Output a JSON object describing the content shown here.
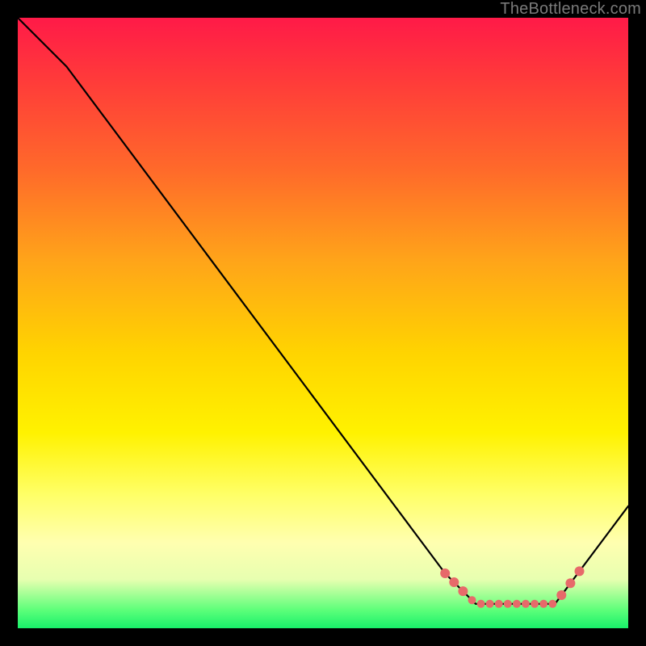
{
  "attribution": "TheBottleneck.com",
  "chart_data": {
    "type": "line",
    "title": "",
    "xlabel": "",
    "ylabel": "",
    "xlim": [
      0,
      100
    ],
    "ylim": [
      0,
      100
    ],
    "background_gradient_note": "vertical red→yellow→green gradient",
    "x": [
      0,
      8,
      70,
      75,
      88,
      100
    ],
    "values": [
      100,
      92,
      9,
      4,
      4,
      20
    ],
    "marker_segment": {
      "x_range": [
        70,
        92
      ],
      "y_approx": 4,
      "color": "#e76a6a"
    }
  }
}
